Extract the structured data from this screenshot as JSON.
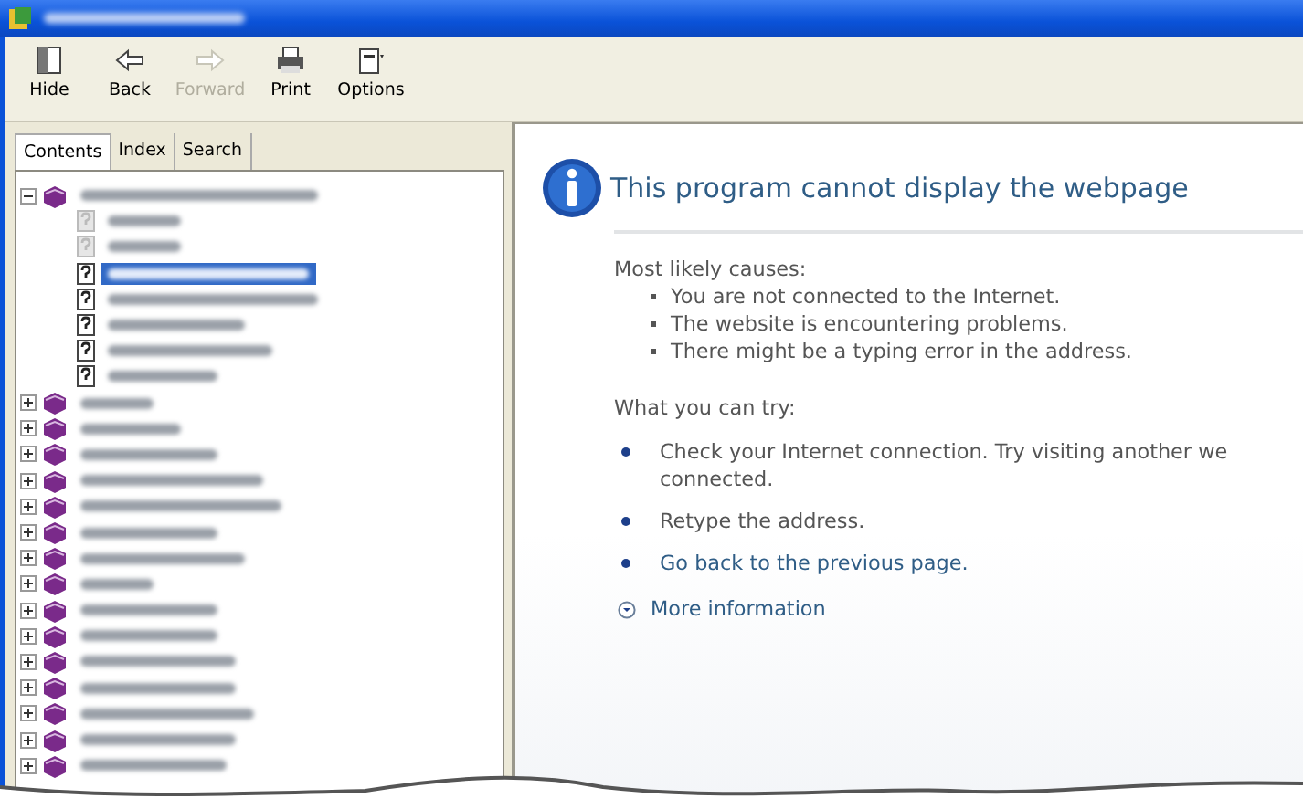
{
  "toolbar": [
    {
      "label": "Hide",
      "kind": "hide",
      "disabled": false
    },
    {
      "label": "Back",
      "kind": "back",
      "disabled": false
    },
    {
      "label": "Forward",
      "kind": "forward",
      "disabled": true
    },
    {
      "label": "Print",
      "kind": "print",
      "disabled": false
    },
    {
      "label": "Options",
      "kind": "options",
      "disabled": false
    }
  ],
  "tabs": [
    {
      "label": "Contents",
      "selected": true
    },
    {
      "label": "Index",
      "selected": false
    },
    {
      "label": "Search",
      "selected": false
    }
  ],
  "tree": [
    {
      "kind": "book",
      "expanded": true,
      "selected": false,
      "children": [
        {
          "kind": "page",
          "dimmed": true,
          "selected": false
        },
        {
          "kind": "page",
          "dimmed": true,
          "selected": false
        },
        {
          "kind": "page",
          "dimmed": false,
          "selected": true
        },
        {
          "kind": "page",
          "dimmed": false,
          "selected": false
        },
        {
          "kind": "page",
          "dimmed": false,
          "selected": false
        },
        {
          "kind": "page",
          "dimmed": false,
          "selected": false
        },
        {
          "kind": "page",
          "dimmed": false,
          "selected": false
        }
      ]
    },
    {
      "kind": "book",
      "expanded": false,
      "selected": false
    },
    {
      "kind": "book",
      "expanded": false,
      "selected": false
    },
    {
      "kind": "book",
      "expanded": false,
      "selected": false
    },
    {
      "kind": "book",
      "expanded": false,
      "selected": false
    },
    {
      "kind": "book",
      "expanded": false,
      "selected": false
    },
    {
      "kind": "book",
      "expanded": false,
      "selected": false
    },
    {
      "kind": "book",
      "expanded": false,
      "selected": false
    },
    {
      "kind": "book",
      "expanded": false,
      "selected": false
    },
    {
      "kind": "book",
      "expanded": false,
      "selected": false
    },
    {
      "kind": "book",
      "expanded": false,
      "selected": false
    },
    {
      "kind": "book",
      "expanded": false,
      "selected": false
    },
    {
      "kind": "book",
      "expanded": false,
      "selected": false
    },
    {
      "kind": "book",
      "expanded": false,
      "selected": false
    },
    {
      "kind": "book",
      "expanded": false,
      "selected": false
    },
    {
      "kind": "book",
      "expanded": false,
      "selected": false
    }
  ],
  "page": {
    "heading": "This program cannot display the webpage",
    "causes_title": "Most likely causes:",
    "causes": [
      "You are not connected to the Internet.",
      "The website is encountering problems.",
      "There might be a typing error in the address."
    ],
    "try_title": "What you can try:",
    "tries": [
      {
        "kind": "text",
        "lines": [
          "Check your Internet connection. Try visiting another we",
          "connected."
        ]
      },
      {
        "kind": "text",
        "lines": [
          "Retype the address."
        ]
      },
      {
        "kind": "link",
        "lines": [
          "Go back to the previous page."
        ]
      }
    ],
    "more": {
      "label": "More information",
      "expanded": false
    }
  }
}
